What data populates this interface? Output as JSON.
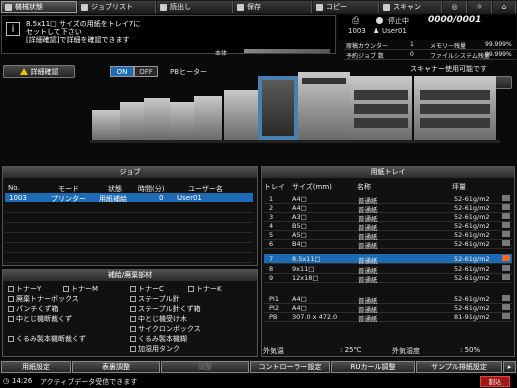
{
  "tabs": [
    {
      "label": "機械状態",
      "icon": "machine-icon"
    },
    {
      "label": "ジョブリスト",
      "icon": "job-list-icon"
    },
    {
      "label": "読出し",
      "icon": "recall-icon"
    },
    {
      "label": "保存",
      "icon": "save-icon"
    },
    {
      "label": "コピー",
      "icon": "copy-icon"
    },
    {
      "label": "スキャン",
      "icon": "scan-icon"
    }
  ],
  "message": "8.5x11□ サイズの用紙をトレイ7に\nセットして下さい\n[詳細確認]で詳細を確認できます",
  "toner_label": "本体",
  "status": {
    "state": "停止中",
    "counter": "0000/0001",
    "job_count": "1003",
    "user": "User01"
  },
  "stats": [
    {
      "k": "原稿カウンター",
      "v": "1",
      "k2": "メモリー残量",
      "v2": "99.999%"
    },
    {
      "k": "予約ジョブ 数",
      "v": "0",
      "k2": "ファイルシステム残量",
      "v2": "99.999%"
    }
  ],
  "detail_button": "詳細確認",
  "pb_heater": {
    "on": "ON",
    "off": "OFF",
    "label": "PBヒーター"
  },
  "scanner_status": "スキャナー使用可能です",
  "sample_output": "サンプル排紙出力",
  "job_panel": {
    "title": "ジョブ",
    "headers": [
      "No.",
      "モード",
      "状態",
      "時間(分)",
      "ユーザー名"
    ],
    "rows": [
      {
        "no": "1003",
        "mode": "プリンター",
        "state": "用紙補給",
        "time": "0",
        "user": "User01"
      }
    ]
  },
  "supply_panel": {
    "title": "補給/廃棄部材",
    "items": [
      {
        "label": "トナーY",
        "col": 0,
        "row": 0
      },
      {
        "label": "トナーM",
        "col": 1,
        "row": 0
      },
      {
        "label": "トナーC",
        "col": 2,
        "row": 0
      },
      {
        "label": "トナーK",
        "col": 3,
        "row": 0
      },
      {
        "label": "廃棄トナーボックス",
        "col": 0,
        "row": 1
      },
      {
        "label": "ステープル針",
        "col": 2,
        "row": 1
      },
      {
        "label": "パンチくず箱",
        "col": 0,
        "row": 2
      },
      {
        "label": "ステープル針くず箱",
        "col": 2,
        "row": 2
      },
      {
        "label": "中とじ機断裁くず",
        "col": 0,
        "row": 3
      },
      {
        "label": "中とじ機受け木",
        "col": 2,
        "row": 3
      },
      {
        "label": "サイクロンボックス",
        "col": 2,
        "row": 4
      },
      {
        "label": "くるみ製本機断裁くず",
        "col": 0,
        "row": 5
      },
      {
        "label": "くるみ製本機糊",
        "col": 2,
        "row": 5
      },
      {
        "label": "加湿用タンク",
        "col": 2,
        "row": 6
      }
    ]
  },
  "paper_panel": {
    "title": "用紙トレイ",
    "headers": [
      "トレイ",
      "サイズ(mm)",
      "名称",
      "坪量"
    ],
    "rows": [
      {
        "tray": "1",
        "size": "A4□",
        "name": "普通紙",
        "weight": "52-61g/m2"
      },
      {
        "tray": "2",
        "size": "A4□",
        "name": "普通紙",
        "weight": "52-61g/m2"
      },
      {
        "tray": "3",
        "size": "A3□",
        "name": "普通紙",
        "weight": "52-61g/m2"
      },
      {
        "tray": "4",
        "size": "B5□",
        "name": "普通紙",
        "weight": "52-61g/m2"
      },
      {
        "tray": "5",
        "size": "A5□",
        "name": "普通紙",
        "weight": "52-61g/m2"
      },
      {
        "tray": "6",
        "size": "B4□",
        "name": "普通紙",
        "weight": "52-61g/m2"
      },
      {
        "tray": "7",
        "size": "8.5x11□",
        "name": "普通紙",
        "weight": "52-61g/m2"
      },
      {
        "tray": "8",
        "size": "9x11□",
        "name": "普通紙",
        "weight": "52-61g/m2"
      },
      {
        "tray": "9",
        "size": "12x18□",
        "name": "普通紙",
        "weight": "52-61g/m2"
      },
      {
        "tray": "PI1",
        "size": "A4□",
        "name": "普通紙",
        "weight": "52-61g/m2"
      },
      {
        "tray": "PI2",
        "size": "A4□",
        "name": "普通紙",
        "weight": "52-61g/m2"
      },
      {
        "tray": "PB",
        "size": "307.0 x 472.0",
        "name": "普通紙",
        "weight": "81-91g/m2"
      }
    ],
    "temp_label": "外気温",
    "temp": ":  25℃",
    "hum_label": "外気湿度",
    "hum": ":  50%"
  },
  "footer_buttons": [
    "用紙設定",
    "表裏調整",
    "調整",
    "コントローラー設定",
    "RUカール調整",
    "サンプル排紙設定"
  ],
  "statusbar": {
    "time": "14:26",
    "msg": "アクティブデータ受信できます",
    "right": "割込"
  },
  "colors": {
    "selected": "#1e6bb5",
    "warning": "#f3c000"
  }
}
